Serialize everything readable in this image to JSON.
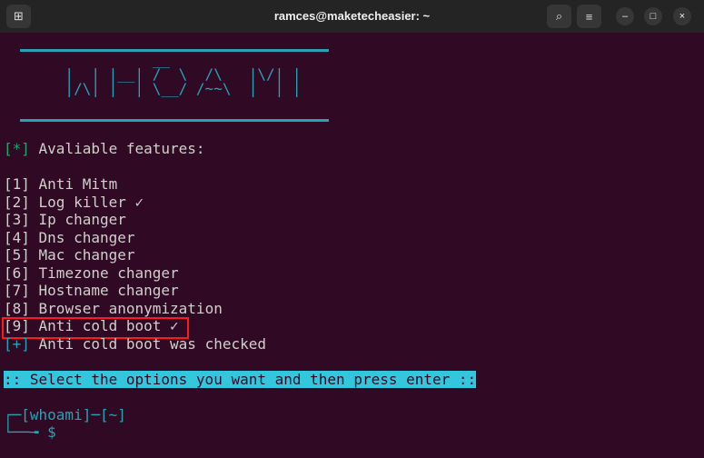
{
  "window": {
    "title": "ramces@maketecheasier: ~",
    "buttons": {
      "new_tab": "⊞",
      "search": "⌕",
      "menu": "≡",
      "minimize": "–",
      "maximize": "□",
      "close": "×"
    }
  },
  "banner": {
    "art": [
      "                 __",
      "       |  | |__| /  \\  /\\   |\\/| |",
      "       |/\\| |  | \\__/ /~~\\  |  | |"
    ]
  },
  "header": {
    "marker": "[*]",
    "text": " Avaliable features:"
  },
  "features": [
    {
      "num": "[1]",
      "label": " Anti Mitm"
    },
    {
      "num": "[2]",
      "label": " Log killer ✓"
    },
    {
      "num": "[3]",
      "label": " Ip changer"
    },
    {
      "num": "[4]",
      "label": " Dns changer"
    },
    {
      "num": "[5]",
      "label": " Mac changer"
    },
    {
      "num": "[6]",
      "label": " Timezone changer"
    },
    {
      "num": "[7]",
      "label": " Hostname changer"
    },
    {
      "num": "[8]",
      "label": " Browser anonymization"
    },
    {
      "num": "[9]",
      "label": " Anti cold boot ✓"
    }
  ],
  "status": {
    "marker": "[+]",
    "text": " Anti cold boot was checked"
  },
  "instruction": ":: Select the options you want and then press enter ::",
  "prompt": {
    "line1": "┌─[whoami]─[~]",
    "line2": "└──╼ $"
  },
  "colors": {
    "background": "#300a24",
    "accent": "#2aa1b3",
    "highlight": "#33c7de",
    "green": "#26a269",
    "annotation": "#ff1a1a"
  }
}
